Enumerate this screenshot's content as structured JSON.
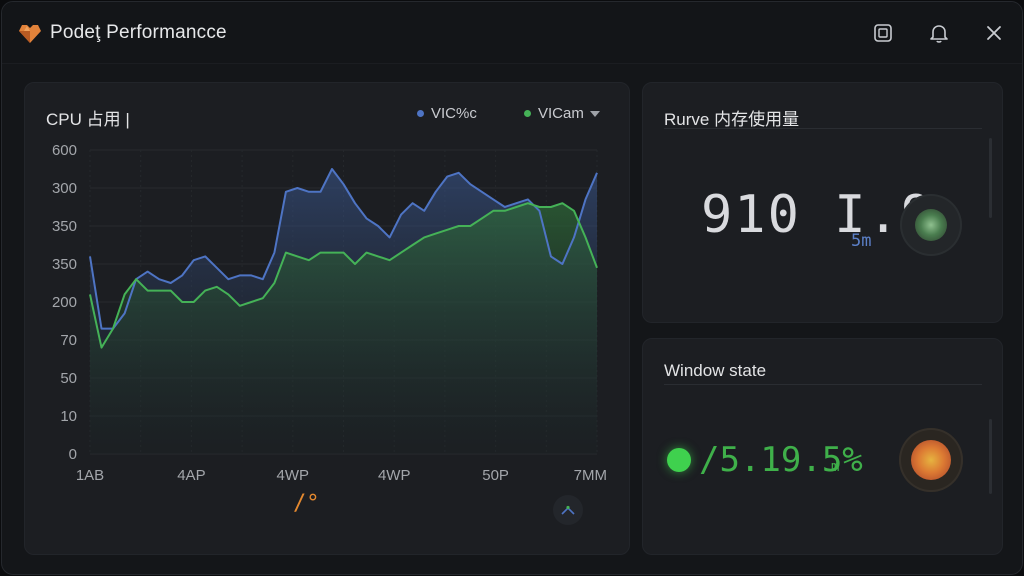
{
  "window": {
    "title": "Podeţ Performancce"
  },
  "titlebar": {
    "icons": [
      "app-logo-icon",
      "screenshot-icon",
      "bell-icon",
      "close-icon"
    ]
  },
  "cpu": {
    "title": "CPU 占用 |",
    "legend": [
      {
        "label": "VIC%c",
        "color": "#4e74c4"
      },
      {
        "label": "VICam",
        "color": "#45b257"
      }
    ],
    "footer_mark": "/°"
  },
  "memory": {
    "title": "Rurve 内存使用量",
    "value": "910 I.9.",
    "unit": "5m"
  },
  "window_state": {
    "title": "Window state",
    "value": "/5.19.5%",
    "unit": "m",
    "status_color": "#3fd14e"
  },
  "chart_data": {
    "type": "area",
    "y_ticks": [
      "600",
      "300",
      "350",
      "350",
      "200",
      "70",
      "50",
      "10",
      "0"
    ],
    "x_ticks": [
      "1AB",
      "4AP",
      "4WP",
      "4WP",
      "50P",
      "7MM"
    ],
    "grid": true,
    "legend_position": "top-right",
    "series": [
      {
        "name": "VIC%c",
        "color": "#4e74c4",
        "values": [
          5.2,
          3.3,
          3.3,
          3.7,
          4.6,
          4.8,
          4.6,
          4.5,
          4.7,
          5.1,
          5.2,
          4.9,
          4.6,
          4.7,
          4.7,
          4.6,
          5.3,
          6.9,
          7.0,
          6.9,
          6.9,
          7.5,
          7.1,
          6.6,
          6.2,
          6.0,
          5.7,
          6.3,
          6.6,
          6.4,
          6.9,
          7.3,
          7.4,
          7.1,
          6.9,
          6.7,
          6.5,
          6.6,
          6.7,
          6.4,
          5.2,
          5.0,
          5.7,
          6.7,
          7.4
        ]
      },
      {
        "name": "VICam",
        "color": "#45b257",
        "values": [
          4.2,
          2.8,
          3.3,
          4.2,
          4.6,
          4.3,
          4.3,
          4.3,
          4.0,
          4.0,
          4.3,
          4.4,
          4.2,
          3.9,
          4.0,
          4.1,
          4.5,
          5.3,
          5.2,
          5.1,
          5.3,
          5.3,
          5.3,
          5.0,
          5.3,
          5.2,
          5.1,
          5.3,
          5.5,
          5.7,
          5.8,
          5.9,
          6.0,
          6.0,
          6.2,
          6.4,
          6.4,
          6.5,
          6.6,
          6.5,
          6.5,
          6.6,
          6.4,
          5.7,
          4.9
        ]
      }
    ]
  }
}
